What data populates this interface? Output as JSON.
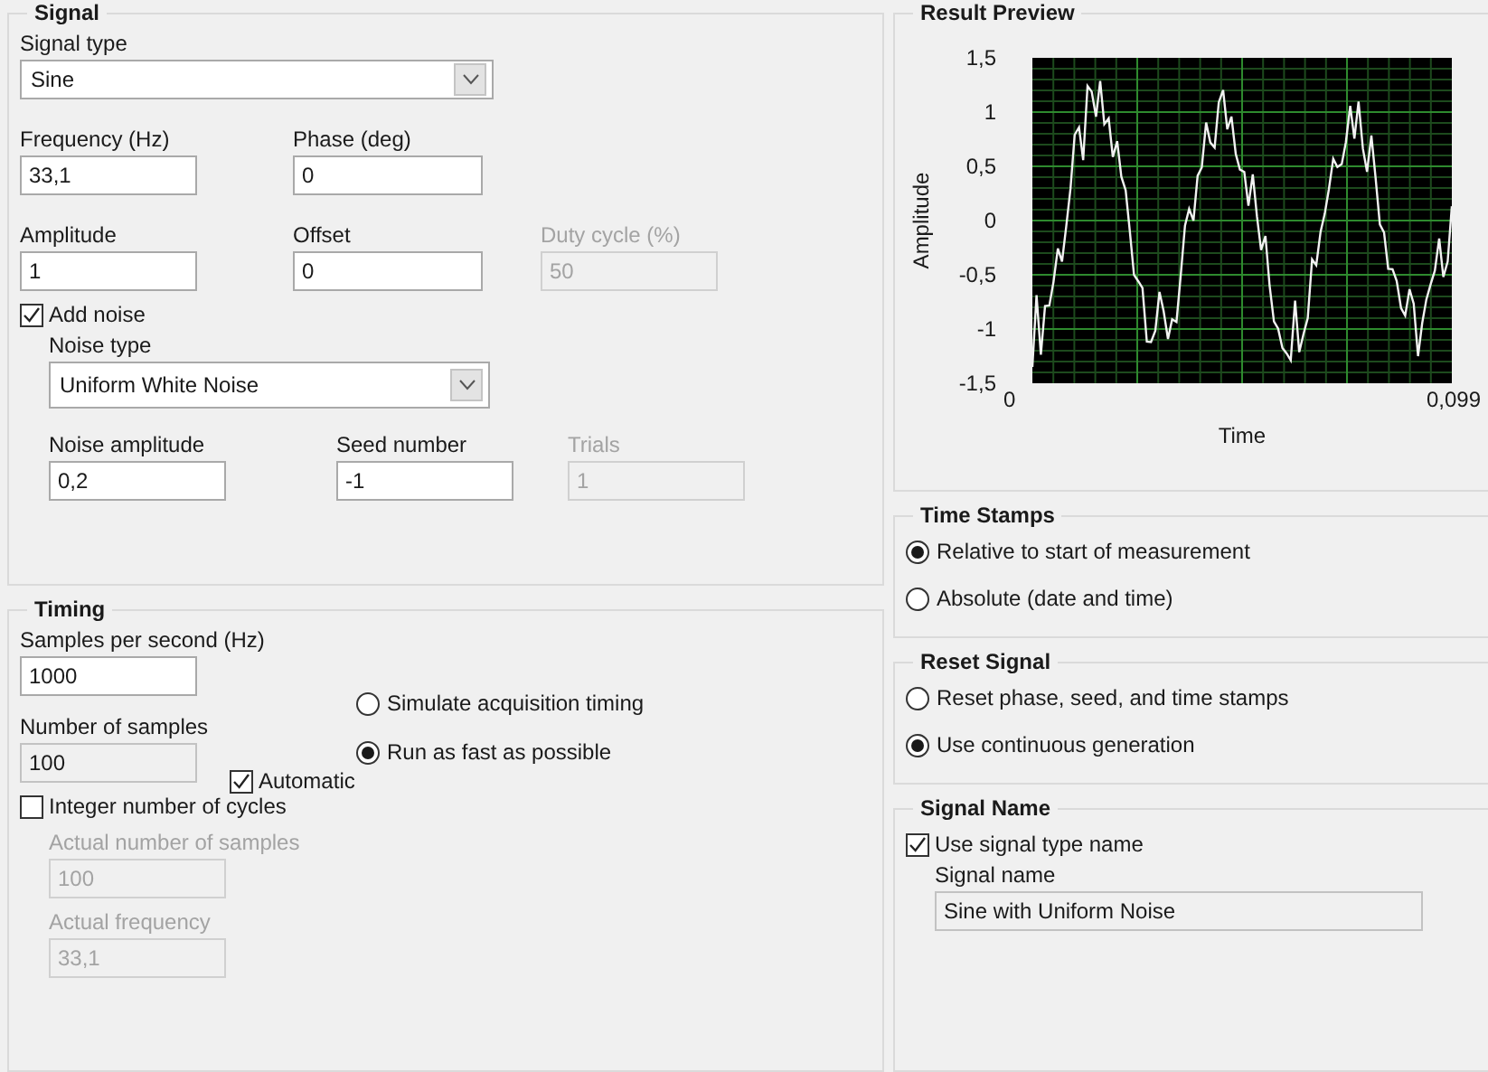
{
  "signal": {
    "title": "Signal",
    "signal_type": {
      "label": "Signal type",
      "value": "Sine"
    },
    "fields": [
      [
        {
          "label": "Frequency (Hz)",
          "value": "33,1",
          "disabled": false
        },
        {
          "label": "Phase (deg)",
          "value": "0",
          "disabled": false
        }
      ],
      [
        {
          "label": "Amplitude",
          "value": "1",
          "disabled": false
        },
        {
          "label": "Offset",
          "value": "0",
          "disabled": false
        },
        {
          "label": "Duty cycle (%)",
          "value": "50",
          "disabled": true
        }
      ]
    ],
    "add_noise": {
      "label": "Add noise",
      "checked": true
    },
    "noise_type": {
      "label": "Noise type",
      "value": "Uniform White Noise"
    },
    "noise_fields": [
      {
        "label": "Noise amplitude",
        "value": "0,2",
        "disabled": false
      },
      {
        "label": "Seed number",
        "value": "-1",
        "disabled": false
      },
      {
        "label": "Trials",
        "value": "1",
        "disabled": true
      }
    ]
  },
  "timing": {
    "title": "Timing",
    "samples_per_second": {
      "label": "Samples per second (Hz)",
      "value": "1000",
      "disabled": false
    },
    "number_of_samples": {
      "label": "Number of samples",
      "value": "100",
      "disabled": false,
      "readonly": true
    },
    "automatic": {
      "label": "Automatic",
      "checked": true
    },
    "mode": [
      {
        "label": "Simulate acquisition timing",
        "selected": false
      },
      {
        "label": "Run as fast as possible",
        "selected": true
      }
    ],
    "integer_cycles": {
      "label": "Integer number of cycles",
      "checked": false
    },
    "actual_fields": [
      {
        "label": "Actual number of samples",
        "value": "100",
        "disabled": true
      },
      {
        "label": "Actual frequency",
        "value": "33,1",
        "disabled": true
      }
    ]
  },
  "result_preview": {
    "title": "Result Preview",
    "graph": {
      "ylabel": "Amplitude",
      "xlabel": "Time",
      "yticks": [
        "1,5",
        "1",
        "0,5",
        "0",
        "-0,5",
        "-1",
        "-1,5"
      ],
      "xticks": [
        "0",
        "0,099"
      ]
    }
  },
  "time_stamps": {
    "title": "Time Stamps",
    "options": [
      {
        "label": "Relative to start of measurement",
        "selected": true
      },
      {
        "label": "Absolute (date and time)",
        "selected": false
      }
    ]
  },
  "reset_signal": {
    "title": "Reset Signal",
    "options": [
      {
        "label": "Reset phase, seed, and time stamps",
        "selected": false
      },
      {
        "label": "Use continuous generation",
        "selected": true
      }
    ]
  },
  "signal_name": {
    "title": "Signal Name",
    "use_type_name": {
      "label": "Use signal type name",
      "checked": true
    },
    "name": {
      "label": "Signal name",
      "value": "Sine with Uniform Noise",
      "readonly": true
    }
  }
}
